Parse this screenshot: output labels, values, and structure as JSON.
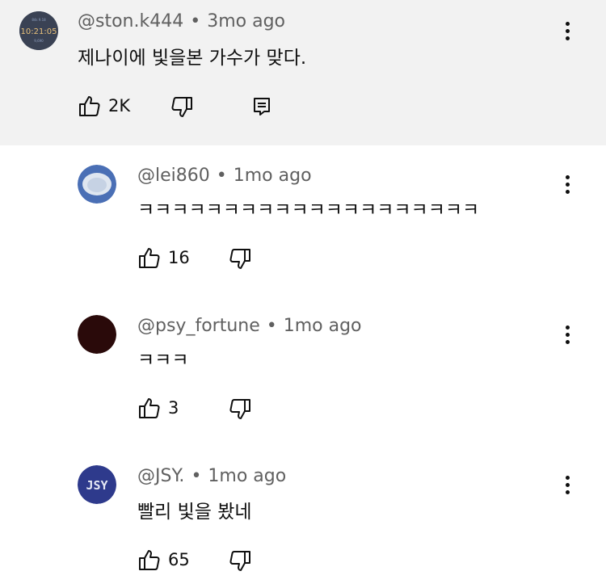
{
  "comments": [
    {
      "handle": "@ston.k444",
      "age": "3mo ago",
      "text": "제나이에 빛을본 가수가 맞다.",
      "likes": "2K",
      "avatar_text": "10:21:05",
      "avatar_bg": "#3a4254"
    },
    {
      "handle": "@lei860",
      "age": "1mo ago",
      "text": "ㅋㅋㅋㅋㅋㅋㅋㅋㅋㅋㅋㅋㅋㅋㅋㅋㅋㅋㅋㅋ",
      "likes": "16",
      "avatar_bg": "#4a6fb5"
    },
    {
      "handle": "@psy_fortune",
      "age": "1mo ago",
      "text": "ㅋㅋㅋ",
      "likes": "3",
      "avatar_bg": "#2a0a0a"
    },
    {
      "handle": "@JSY.",
      "age": "1mo ago",
      "text": "빨리 빛을 봤네",
      "likes": "65",
      "avatar_text": "JSY",
      "avatar_bg": "#2e3a8c"
    }
  ],
  "separator": "•"
}
